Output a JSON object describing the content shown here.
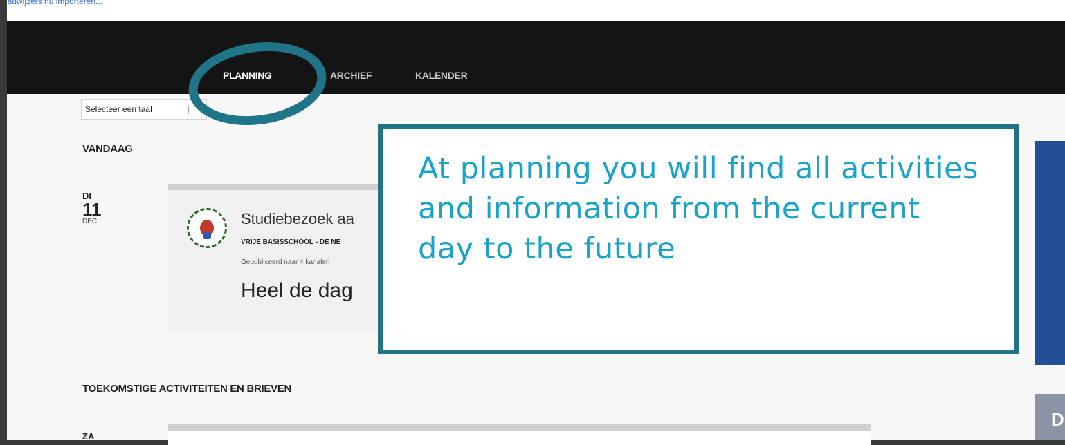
{
  "browser": {
    "bookmarks_text": "Bladwijzers nu importeren..."
  },
  "nav": {
    "items": [
      {
        "label": "PLANNING"
      },
      {
        "label": "ARCHIEF"
      },
      {
        "label": "KALENDER"
      }
    ]
  },
  "language_select": {
    "value": "Selecteer een taal",
    "separator": "|",
    "arrow": "▼"
  },
  "today_section": {
    "title": "VANDAAG",
    "date": {
      "day_of_week": "DI",
      "day": "11",
      "month": "DEC."
    },
    "card": {
      "title": "Studiebezoek aa",
      "school": "VRIJE BASISSCHOOL - DE NE",
      "published": "Gepubliceerd naar 4 kanalen",
      "when": "Heel de dag"
    }
  },
  "future_section": {
    "title": "TOEKOMSTIGE ACTIVITEITEN EN BRIEVEN",
    "first_date": {
      "day_of_week": "ZA"
    }
  },
  "callout": {
    "text": "At planning you will find all activities and information from the current day to the future"
  },
  "side_banner": {
    "letter": "D"
  },
  "colors": {
    "accent_ring": "#1f7587",
    "callout_text": "#1aa3c8",
    "navbar": "#141414"
  }
}
